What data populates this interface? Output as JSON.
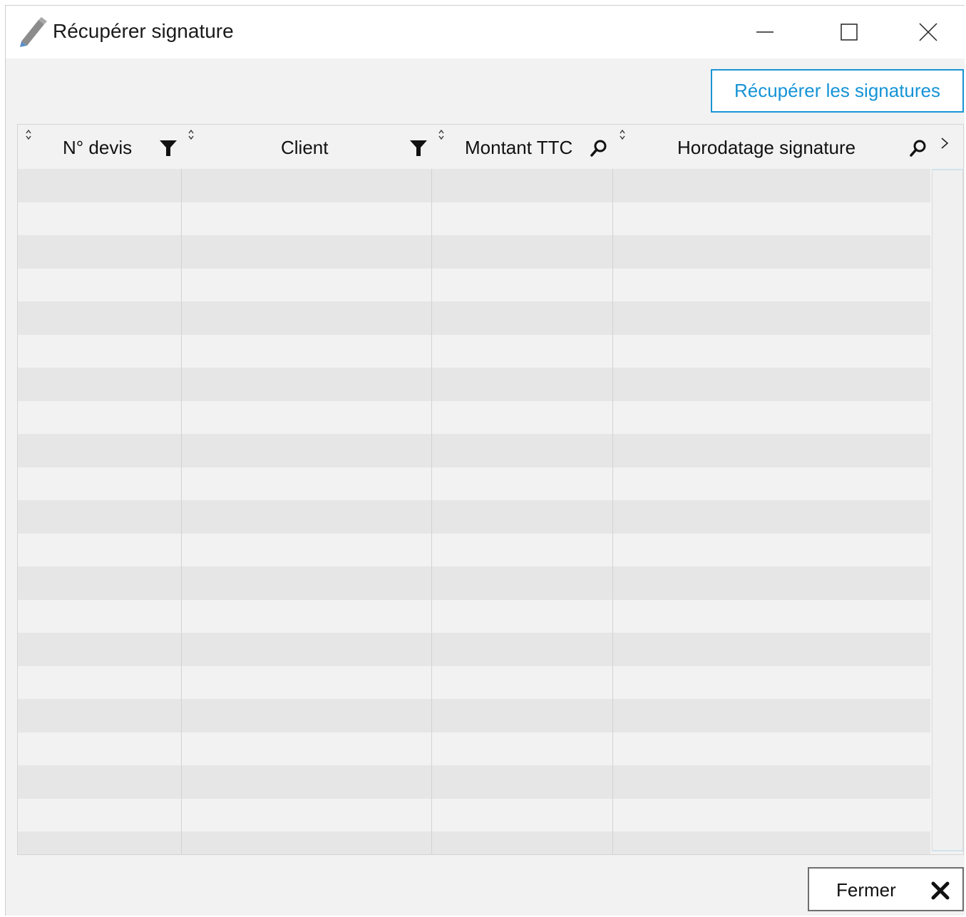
{
  "window": {
    "title": "Récupérer signature",
    "app_icon": "pencil-icon",
    "controls": [
      "minimize-icon",
      "maximize-icon",
      "close-icon"
    ]
  },
  "toolbar": {
    "fetch_button_label": "Récupérer les signatures",
    "accent_color": "#1593d6"
  },
  "grid": {
    "columns": [
      {
        "label": "N° devis",
        "icon": "filter-icon"
      },
      {
        "label": "Client",
        "icon": "filter-icon"
      },
      {
        "label": "Montant TTC",
        "icon": "search-icon"
      },
      {
        "label": "Horodatage signature",
        "icon": "search-icon"
      }
    ],
    "sort_icon": "sort-icon",
    "scroll_icon": "chevron-right-icon",
    "rows": [],
    "visible_empty_rows": 21,
    "row_colors": [
      "#e6e6e6",
      "#f2f2f2"
    ]
  },
  "footer": {
    "close_button_label": "Fermer",
    "close_button_icon": "x-icon"
  }
}
